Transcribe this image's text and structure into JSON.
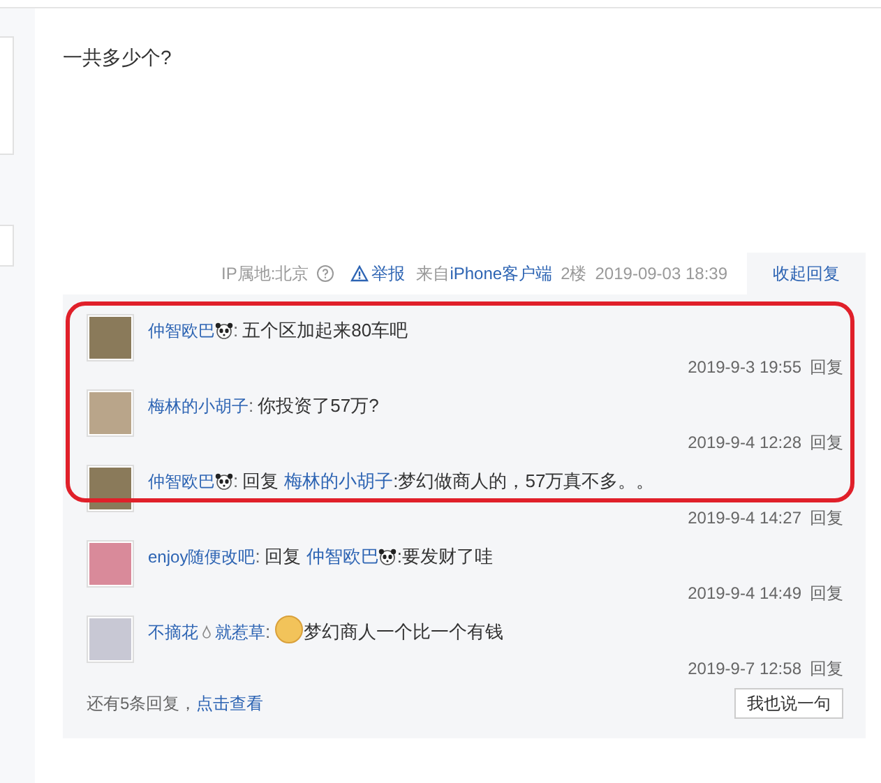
{
  "post": {
    "text": "一共多少个?",
    "ip_label": "IP属地:北京",
    "report": "举报",
    "source_prefix": "来自",
    "source_link": "iPhone客户端",
    "floor": "2楼",
    "time": "2019-09-03 18:39",
    "collapse_tab": "收起回复"
  },
  "replies": [
    {
      "author": [
        "仲智欧巴"
      ],
      "author_badge": true,
      "separator": ":",
      "text": "五个区加起来80车吧",
      "time": "2019-9-3 19:55",
      "action": "回复",
      "highlighted": true
    },
    {
      "author": [
        "梅林的小胡子"
      ],
      "separator": ":",
      "text": "你投资了57万?",
      "time": "2019-9-4 12:28",
      "action": "回复",
      "highlighted": true
    },
    {
      "author": [
        "仲智欧巴"
      ],
      "author_badge": true,
      "separator": ":",
      "reply_label": "回复",
      "reply_to": "梅林的小胡子",
      "text": ":梦幻做商人的，57万真不多。。",
      "time": "2019-9-4 14:27",
      "action": "回复",
      "highlighted": true
    },
    {
      "author": [
        "enjoy随便改吧"
      ],
      "separator": ":",
      "reply_label": "回复",
      "reply_to": "仲智欧巴",
      "reply_to_badge": true,
      "text": ":要发财了哇",
      "time": "2019-9-4 14:49",
      "action": "回复",
      "highlighted": false
    },
    {
      "author": [
        "不摘花",
        "就惹草"
      ],
      "separator": ":",
      "text": "梦幻商人一个比一个有钱",
      "sticker": true,
      "time": "2019-9-7 12:58",
      "action": "回复",
      "highlighted": false
    }
  ],
  "footer": {
    "more_text": "还有5条回复，",
    "more_link": "点击查看",
    "say_button": "我也说一句"
  }
}
